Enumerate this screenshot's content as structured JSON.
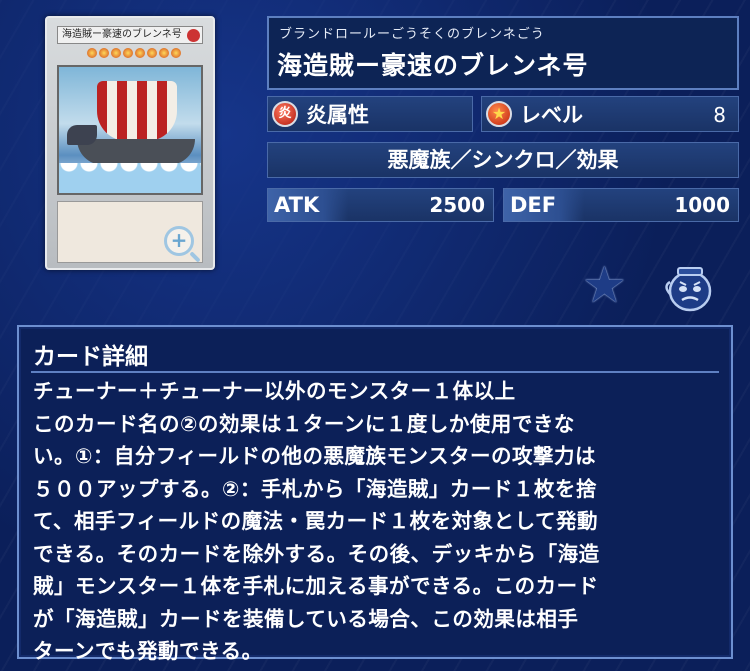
{
  "card": {
    "ruby": "ブランドロールーごうそくのブレンネごう",
    "name": "海造賊ー豪速のブレンネ号",
    "thumb_name": "海造賊ー豪速のブレンネ号",
    "attribute_icon": "炎",
    "attribute": "炎属性",
    "level_label": "レベル",
    "level": "8",
    "type_line": "悪魔族／シンクロ／効果",
    "atk_label": "ATK",
    "atk": "2500",
    "def_label": "DEF",
    "def": "1000"
  },
  "icons": {
    "favorite": "star-icon",
    "deck": "deck-pot-icon",
    "zoom": "zoom-in-icon"
  },
  "detail": {
    "title": "カード詳細",
    "text": "チューナー＋チューナー以外のモンスター１体以上\nこのカード名の②の効果は１ターンに１度しか使用できな\nい。①：自分フィールドの他の悪魔族モンスターの攻撃力は\n５００アップする。②：手札から「海造賊」カード１枚を捨\nて、相手フィールドの魔法・罠カード１枚を対象として発動\nできる。そのカードを除外する。その後、デッキから「海造\n賊」モンスター１体を手札に加える事ができる。このカード\nが「海造賊」カードを装備している場合、この効果は相手\nターンでも発動できる。"
  },
  "colors": {
    "background": "#0b1f5a",
    "panel": "#1a3366",
    "accent": "#6d8fd0"
  }
}
